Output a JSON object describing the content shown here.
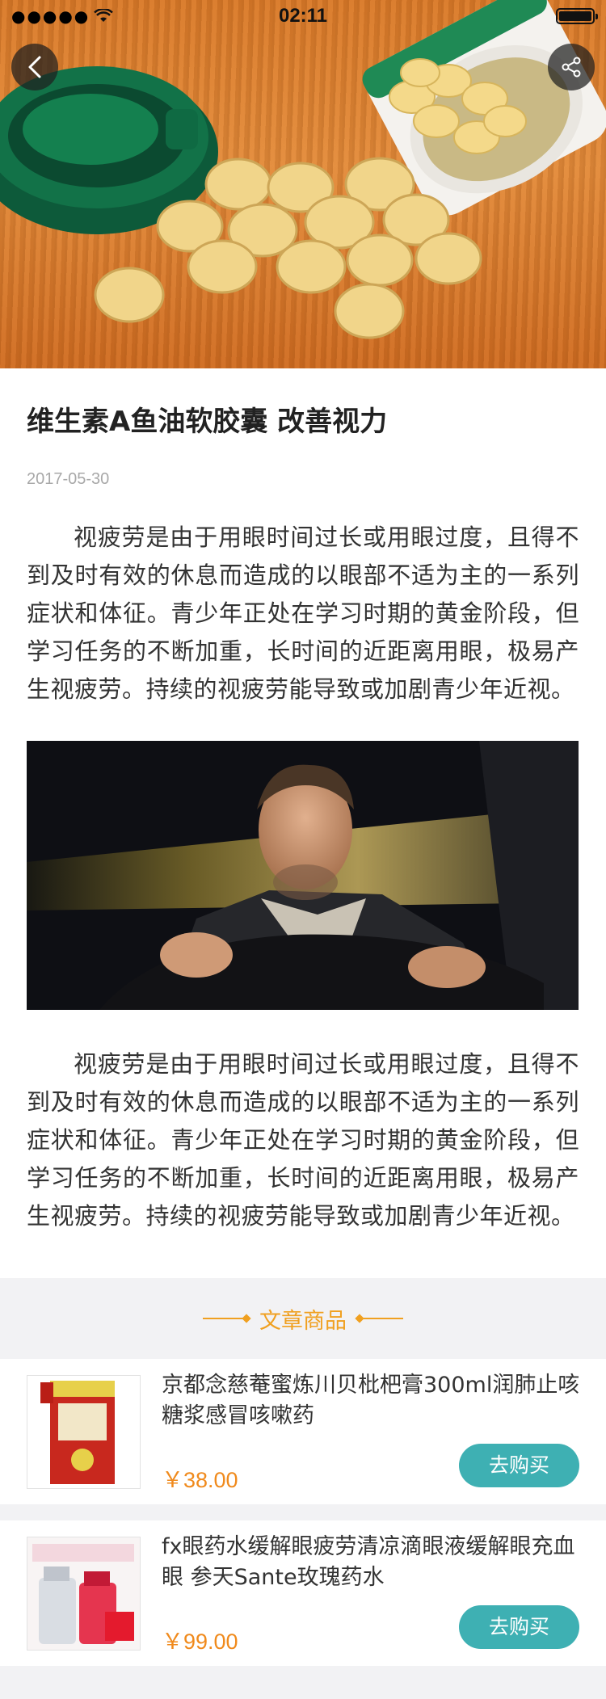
{
  "status_bar": {
    "time": "02:11",
    "signal": "●●●●●"
  },
  "article": {
    "title": "维生素A鱼油软胶囊 改善视力",
    "date": "2017-05-30",
    "paragraph_1": "视疲劳是由于用眼时间过长或用眼过度，且得不到及时有效的休息而造成的以眼部不适为主的一系列症状和体征。青少年正处在学习时期的黄金阶段，但学习任务的不断加重，长时间的近距离用眼，极易产生视疲劳。持续的视疲劳能导致或加剧青少年近视。",
    "paragraph_2": "视疲劳是由于用眼时间过长或用眼过度，且得不到及时有效的休息而造成的以眼部不适为主的一系列症状和体征。青少年正处在学习时期的黄金阶段，但学习任务的不断加重，长时间的近距离用眼，极易产生视疲劳。持续的视疲劳能导致或加剧青少年近视。"
  },
  "products_section": {
    "title": "文章商品",
    "items": [
      {
        "name": "京都念慈菴蜜炼川贝枇杷膏300ml润肺止咳糖浆感冒咳嗽药",
        "price": "￥38.00",
        "buy_label": "去购买"
      },
      {
        "name": "fx眼药水缓解眼疲劳清凉滴眼液缓解眼充血眼 参天Sante玫瑰药水",
        "price": "￥99.00",
        "buy_label": "去购买"
      }
    ]
  },
  "icons": {
    "back": "chevron-left-icon",
    "share": "share-icon",
    "wifi": "wifi-icon",
    "battery": "battery-icon"
  },
  "colors": {
    "accent": "#f0a020",
    "button": "#3eb0b3",
    "price": "#f08a1c"
  }
}
